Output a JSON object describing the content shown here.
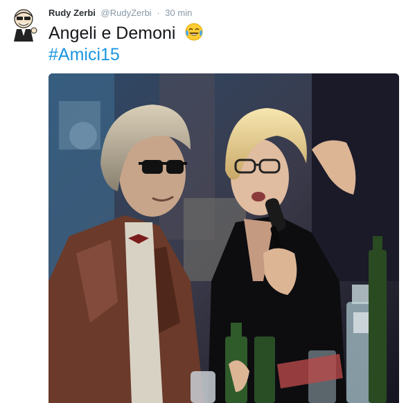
{
  "tweet": {
    "author_name": "Rudy Zerbi",
    "author_handle": "@RudyZerbi",
    "separator": "·",
    "timestamp": "30 min",
    "text_line1": "Angeli e Demoni",
    "hashtag": "#Amici15"
  },
  "icons": {
    "avatar": "cartoon-avatar-icon",
    "emoji": "tears-of-joy-emoji-icon"
  },
  "colors": {
    "name": "#292f33",
    "meta": "#8899a6",
    "text": "#14171a",
    "hashtag": "#1b95e0"
  }
}
